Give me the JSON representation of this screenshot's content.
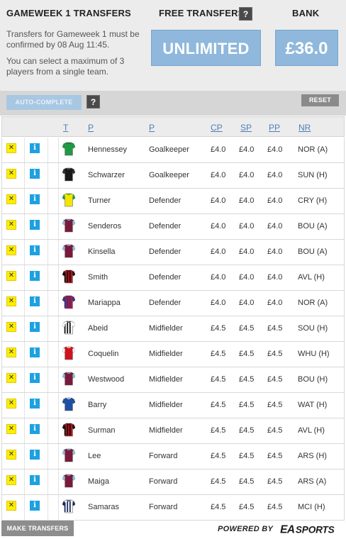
{
  "header": {
    "title": "GAMEWEEK 1 TRANSFERS",
    "desc_line1": "Transfers for Gameweek 1 must be confirmed by 08 Aug 11:45.",
    "desc_line2": "You can select a maximum of 3 players from a single team.",
    "free_transfers_label": "FREE TRANSFERS",
    "free_transfers_value": "UNLIMITED",
    "bank_label": "BANK",
    "bank_value": "£36.0",
    "help_glyph": "?"
  },
  "toolbar": {
    "auto_complete_label": "AUTO-COMPLETE",
    "help_glyph": "?",
    "reset_label": "RESET"
  },
  "table": {
    "columns": {
      "t": "T",
      "p": "P",
      "pos": "P",
      "cp": "CP",
      "sp": "SP",
      "pp": "PP",
      "nr": "NR"
    },
    "remove_glyph": "✕",
    "info_glyph": "i",
    "rows": [
      {
        "name": "Hennessey",
        "position": "Goalkeeper",
        "cp": "£4.0",
        "sp": "£4.0",
        "pp": "£4.0",
        "nr": "NOR (A)",
        "shirt": "green"
      },
      {
        "name": "Schwarzer",
        "position": "Goalkeeper",
        "cp": "£4.0",
        "sp": "£4.0",
        "pp": "£4.0",
        "nr": "SUN (H)",
        "shirt": "black"
      },
      {
        "name": "Turner",
        "position": "Defender",
        "cp": "£4.0",
        "sp": "£4.0",
        "pp": "£4.0",
        "nr": "CRY (H)",
        "shirt": "norwich"
      },
      {
        "name": "Senderos",
        "position": "Defender",
        "cp": "£4.0",
        "sp": "£4.0",
        "pp": "£4.0",
        "nr": "BOU (A)",
        "shirt": "villa"
      },
      {
        "name": "Kinsella",
        "position": "Defender",
        "cp": "£4.0",
        "sp": "£4.0",
        "pp": "£4.0",
        "nr": "BOU (A)",
        "shirt": "villa"
      },
      {
        "name": "Smith",
        "position": "Defender",
        "cp": "£4.0",
        "sp": "£4.0",
        "pp": "£4.0",
        "nr": "AVL (H)",
        "shirt": "bournemouth"
      },
      {
        "name": "Mariappa",
        "position": "Defender",
        "cp": "£4.0",
        "sp": "£4.0",
        "pp": "£4.0",
        "nr": "NOR (A)",
        "shirt": "palace"
      },
      {
        "name": "Abeid",
        "position": "Midfielder",
        "cp": "£4.5",
        "sp": "£4.5",
        "pp": "£4.5",
        "nr": "SOU (H)",
        "shirt": "newcastle"
      },
      {
        "name": "Coquelin",
        "position": "Midfielder",
        "cp": "£4.5",
        "sp": "£4.5",
        "pp": "£4.5",
        "nr": "WHU (H)",
        "shirt": "arsenal"
      },
      {
        "name": "Westwood",
        "position": "Midfielder",
        "cp": "£4.5",
        "sp": "£4.5",
        "pp": "£4.5",
        "nr": "BOU (H)",
        "shirt": "villa"
      },
      {
        "name": "Barry",
        "position": "Midfielder",
        "cp": "£4.5",
        "sp": "£4.5",
        "pp": "£4.5",
        "nr": "WAT (H)",
        "shirt": "everton"
      },
      {
        "name": "Surman",
        "position": "Midfielder",
        "cp": "£4.5",
        "sp": "£4.5",
        "pp": "£4.5",
        "nr": "AVL (H)",
        "shirt": "bournemouth"
      },
      {
        "name": "Lee",
        "position": "Forward",
        "cp": "£4.5",
        "sp": "£4.5",
        "pp": "£4.5",
        "nr": "ARS (H)",
        "shirt": "westham"
      },
      {
        "name": "Maiga",
        "position": "Forward",
        "cp": "£4.5",
        "sp": "£4.5",
        "pp": "£4.5",
        "nr": "ARS (A)",
        "shirt": "westham"
      },
      {
        "name": "Samaras",
        "position": "Forward",
        "cp": "£4.5",
        "sp": "£4.5",
        "pp": "£4.5",
        "nr": "MCI (H)",
        "shirt": "wba"
      }
    ]
  },
  "footer": {
    "make_transfers_label": "MAKE TRANSFERS",
    "powered_by": "POWERED BY",
    "brand_logo_text": "EASPORTS"
  },
  "colors": {
    "accent_blue": "#8fb8dc",
    "link_blue": "#4f7fb5",
    "remove_yellow": "#ffee00",
    "info_blue": "#1da1e0"
  }
}
